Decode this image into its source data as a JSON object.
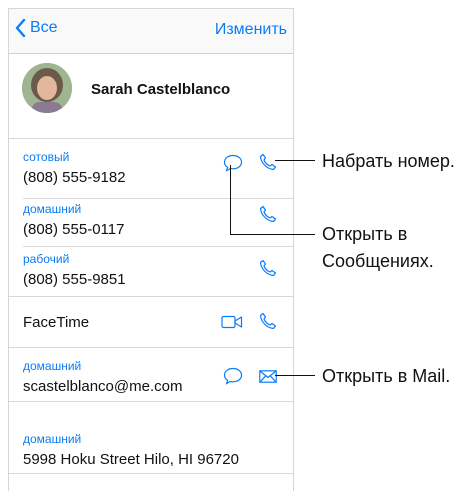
{
  "nav": {
    "back_label": "Все",
    "edit_label": "Изменить"
  },
  "contact": {
    "name": "Sarah Castelblanco"
  },
  "phones": [
    {
      "label": "сотовый",
      "number": "(808) 555-9182"
    },
    {
      "label": "домашний",
      "number": "(808) 555-0117"
    },
    {
      "label": "рабочий",
      "number": "(808) 555-9851"
    }
  ],
  "facetime": {
    "label": "FaceTime"
  },
  "email": {
    "label": "домашний",
    "value": "scastelblanco@me.com"
  },
  "address": {
    "label": "домашний",
    "value": "5998 Hoku Street Hilo, HI 96720"
  },
  "callouts": {
    "dial": "Набрать номер.",
    "messages_line1": "Открыть в",
    "messages_line2": "Сообщениях.",
    "mail": "Открыть в Mail."
  },
  "colors": {
    "accent": "#0a7cf6",
    "separator": "#d8d8d8"
  },
  "icons": {
    "back": "chevron-left-icon",
    "phone": "phone-icon",
    "message": "message-bubble-icon",
    "video": "video-camera-icon",
    "mail": "envelope-icon"
  }
}
